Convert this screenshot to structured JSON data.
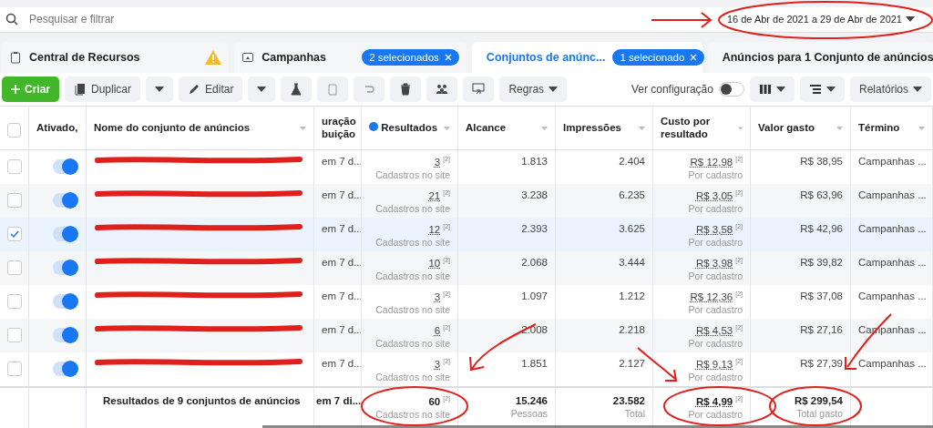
{
  "search": {
    "placeholder": "Pesquisar e filtrar",
    "date_range": "16 de Abr de 2021 a 29 de Abr de 2021"
  },
  "tabs": [
    {
      "label": "Central de Recursos",
      "kind": "resources",
      "warning": true,
      "selected": false
    },
    {
      "label": "Campanhas",
      "kind": "campaigns",
      "badge": "2 selecionados",
      "selected": false
    },
    {
      "label": "Conjuntos de anúnc...",
      "kind": "adsets",
      "badge": "1 selecionado",
      "selected": true
    },
    {
      "label": "Anúncios para 1 Conjunto de anúncios",
      "kind": "ads",
      "selected": false
    }
  ],
  "toolbar": {
    "create": "Criar",
    "duplicate": "Duplicar",
    "edit": "Editar",
    "rules": "Regras",
    "view_setting": "Ver configuração",
    "view_setting_on": false,
    "reports": "Relatórios"
  },
  "table": {
    "select_all": false,
    "columns": [
      "Ativado,",
      "Nome do conjunto de anúncios",
      "uração buição",
      "Resultados",
      "Alcance",
      "Impressões",
      "Custo por resultado",
      "Valor gasto",
      "Término"
    ],
    "rows": [
      {
        "checked": false,
        "on": true,
        "attribution": "em 7 d...",
        "results": "3",
        "results_note": "[2]",
        "results_label": "Cadastros no site",
        "reach": "1.813",
        "impressions": "2.404",
        "cost": "R$ 12,98",
        "cost_note": "[2]",
        "cost_label": "Por cadastro",
        "spent": "R$ 38,95",
        "end": "Campanhas ..."
      },
      {
        "checked": false,
        "on": true,
        "attribution": "em 7 d...",
        "results": "21",
        "results_note": "[2]",
        "results_label": "Cadastros no site",
        "reach": "3.238",
        "impressions": "6.235",
        "cost": "R$ 3,05",
        "cost_note": "[2]",
        "cost_label": "Por cadastro",
        "spent": "R$ 63,96",
        "end": "Campanhas ..."
      },
      {
        "checked": true,
        "on": true,
        "attribution": "em 7 d...",
        "results": "12",
        "results_note": "[2]",
        "results_label": "Cadastros no site",
        "reach": "2.393",
        "impressions": "3.625",
        "cost": "R$ 3,58",
        "cost_note": "[2]",
        "cost_label": "Por cadastro",
        "spent": "R$ 42,96",
        "end": "Campanhas ..."
      },
      {
        "checked": false,
        "on": true,
        "attribution": "em 7 d...",
        "results": "10",
        "results_note": "[2]",
        "results_label": "Cadastros no site",
        "reach": "2.068",
        "impressions": "3.444",
        "cost": "R$ 3,98",
        "cost_note": "[2]",
        "cost_label": "Por cadastro",
        "spent": "R$ 39,82",
        "end": "Campanhas ..."
      },
      {
        "checked": false,
        "on": true,
        "attribution": "em 7 d...",
        "results": "3",
        "results_note": "[2]",
        "results_label": "Cadastros no site",
        "reach": "1.097",
        "impressions": "1.212",
        "cost": "R$ 12,36",
        "cost_note": "[2]",
        "cost_label": "Por cadastro",
        "spent": "R$ 37,08",
        "end": "Campanhas ..."
      },
      {
        "checked": false,
        "on": true,
        "attribution": "em 7 d...",
        "results": "6",
        "results_note": "[2]",
        "results_label": "Cadastros no site",
        "reach": "2.008",
        "impressions": "2.218",
        "cost": "R$ 4,53",
        "cost_note": "[2]",
        "cost_label": "Por cadastro",
        "spent": "R$ 27,16",
        "end": "Campanhas ..."
      },
      {
        "checked": false,
        "on": true,
        "attribution": "em 7 d...",
        "results": "3",
        "results_note": "[2]",
        "results_label": "Cadastros no site",
        "reach": "1.851",
        "impressions": "2.127",
        "cost": "R$ 9,13",
        "cost_note": "[2]",
        "cost_label": "Por cadastro",
        "spent": "R$ 27,39",
        "end": "Campanhas ..."
      }
    ],
    "summary": {
      "label": "Resultados de 9 conjuntos de anúncios",
      "attribution": "em 7 di...",
      "results": "60",
      "results_note": "[2]",
      "results_label": "Cadastros no site",
      "reach": "15.246",
      "reach_label": "Pessoas",
      "impressions": "23.582",
      "impressions_label": "Total",
      "cost": "R$ 4,99",
      "cost_note": "[2]",
      "cost_label": "Por cadastro",
      "spent": "R$ 299,54",
      "spent_label": "Total gasto"
    }
  }
}
